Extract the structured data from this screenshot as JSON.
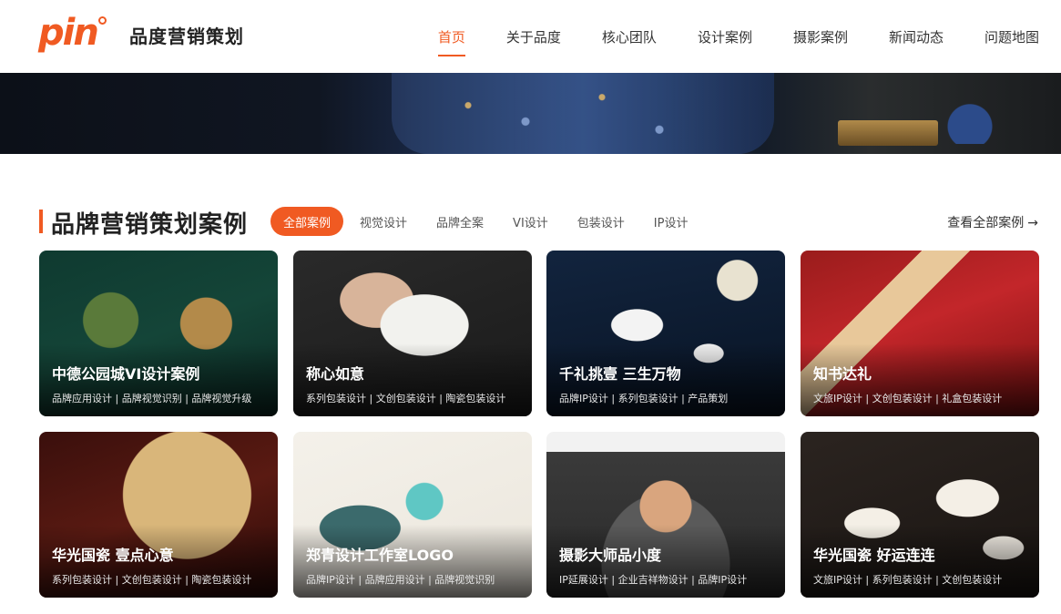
{
  "header": {
    "logo_text": "pin",
    "brand_name": "品度营销策划",
    "nav": [
      {
        "label": "首页",
        "active": true
      },
      {
        "label": "关于品度",
        "active": false
      },
      {
        "label": "核心团队",
        "active": false
      },
      {
        "label": "设计案例",
        "active": false
      },
      {
        "label": "摄影案例",
        "active": false
      },
      {
        "label": "新闻动态",
        "active": false
      },
      {
        "label": "问题地图",
        "active": false
      }
    ]
  },
  "section": {
    "title": "品牌营销策划案例",
    "filters": [
      {
        "label": "全部案例",
        "active": true
      },
      {
        "label": "视觉设计",
        "active": false
      },
      {
        "label": "品牌全案",
        "active": false
      },
      {
        "label": "VI设计",
        "active": false
      },
      {
        "label": "包装设计",
        "active": false
      },
      {
        "label": "IP设计",
        "active": false
      }
    ],
    "view_all": "查看全部案例",
    "view_all_icon": "arrow-right-icon"
  },
  "cards": [
    {
      "title": "中德公园城VI设计案例",
      "tags": "品牌应用设计 | 品牌视觉识别 | 品牌视觉升级"
    },
    {
      "title": "称心如意",
      "tags": "系列包装设计 | 文创包装设计 | 陶瓷包装设计"
    },
    {
      "title": "千礼挑壹 三生万物",
      "tags": "品牌IP设计 | 系列包装设计 | 产品策划"
    },
    {
      "title": "知书达礼",
      "tags": "文旅IP设计 | 文创包装设计 | 礼盒包装设计"
    },
    {
      "title": "华光国瓷 壹点心意",
      "tags": "系列包装设计 | 文创包装设计 | 陶瓷包装设计"
    },
    {
      "title": "郑青设计工作室LOGO",
      "tags": "品牌IP设计 | 品牌应用设计 | 品牌视觉识别"
    },
    {
      "title": "摄影大师品小度",
      "tags": "IP延展设计 | 企业吉祥物设计 | 品牌IP设计"
    },
    {
      "title": "华光国瓷 好运连连",
      "tags": "文旅IP设计 | 系列包装设计 | 文创包装设计"
    }
  ],
  "colors": {
    "accent": "#f05a22"
  }
}
